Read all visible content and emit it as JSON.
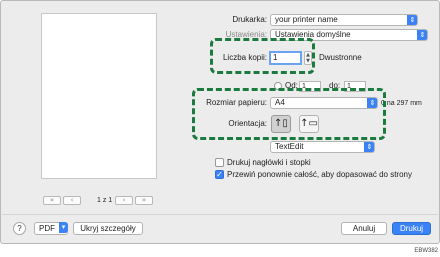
{
  "printer": {
    "label": "Drukarka:",
    "value": "your printer name"
  },
  "presets": {
    "label": "Ustawienia:",
    "value": "Ustawienia domyślne"
  },
  "copies": {
    "label": "Liczba kopii:",
    "value": "1",
    "duplex_label": "Dwustronne"
  },
  "pages": {
    "from_label": "Od:",
    "from_value": "1",
    "to_label": "do:",
    "to_value": "1"
  },
  "paper_size": {
    "label": "Rozmiar papieru:",
    "value": "A4",
    "dims": "0 na 297 mm"
  },
  "orientation": {
    "label": "Orientacja:",
    "portrait_icon": "portrait-orientation-icon",
    "landscape_icon": "landscape-orientation-icon",
    "selected": "portrait"
  },
  "app_menu": {
    "value": "TextEdit"
  },
  "options": {
    "print_headers": {
      "label": "Drukuj nagłówki i stopki",
      "checked": false
    },
    "rewrap": {
      "label": "Przewiń ponownie całość, aby dopasować do strony",
      "checked": true
    }
  },
  "preview": {
    "page_label": "1 z 1"
  },
  "footer": {
    "help": "?",
    "pdf_label": "PDF",
    "hide_details": "Ukryj szczegóły",
    "cancel": "Anuluj",
    "print": "Drukuj"
  },
  "figure_code": "EBW382",
  "colors": {
    "accent": "#3a83f7",
    "highlight": "#1b7a3e"
  }
}
